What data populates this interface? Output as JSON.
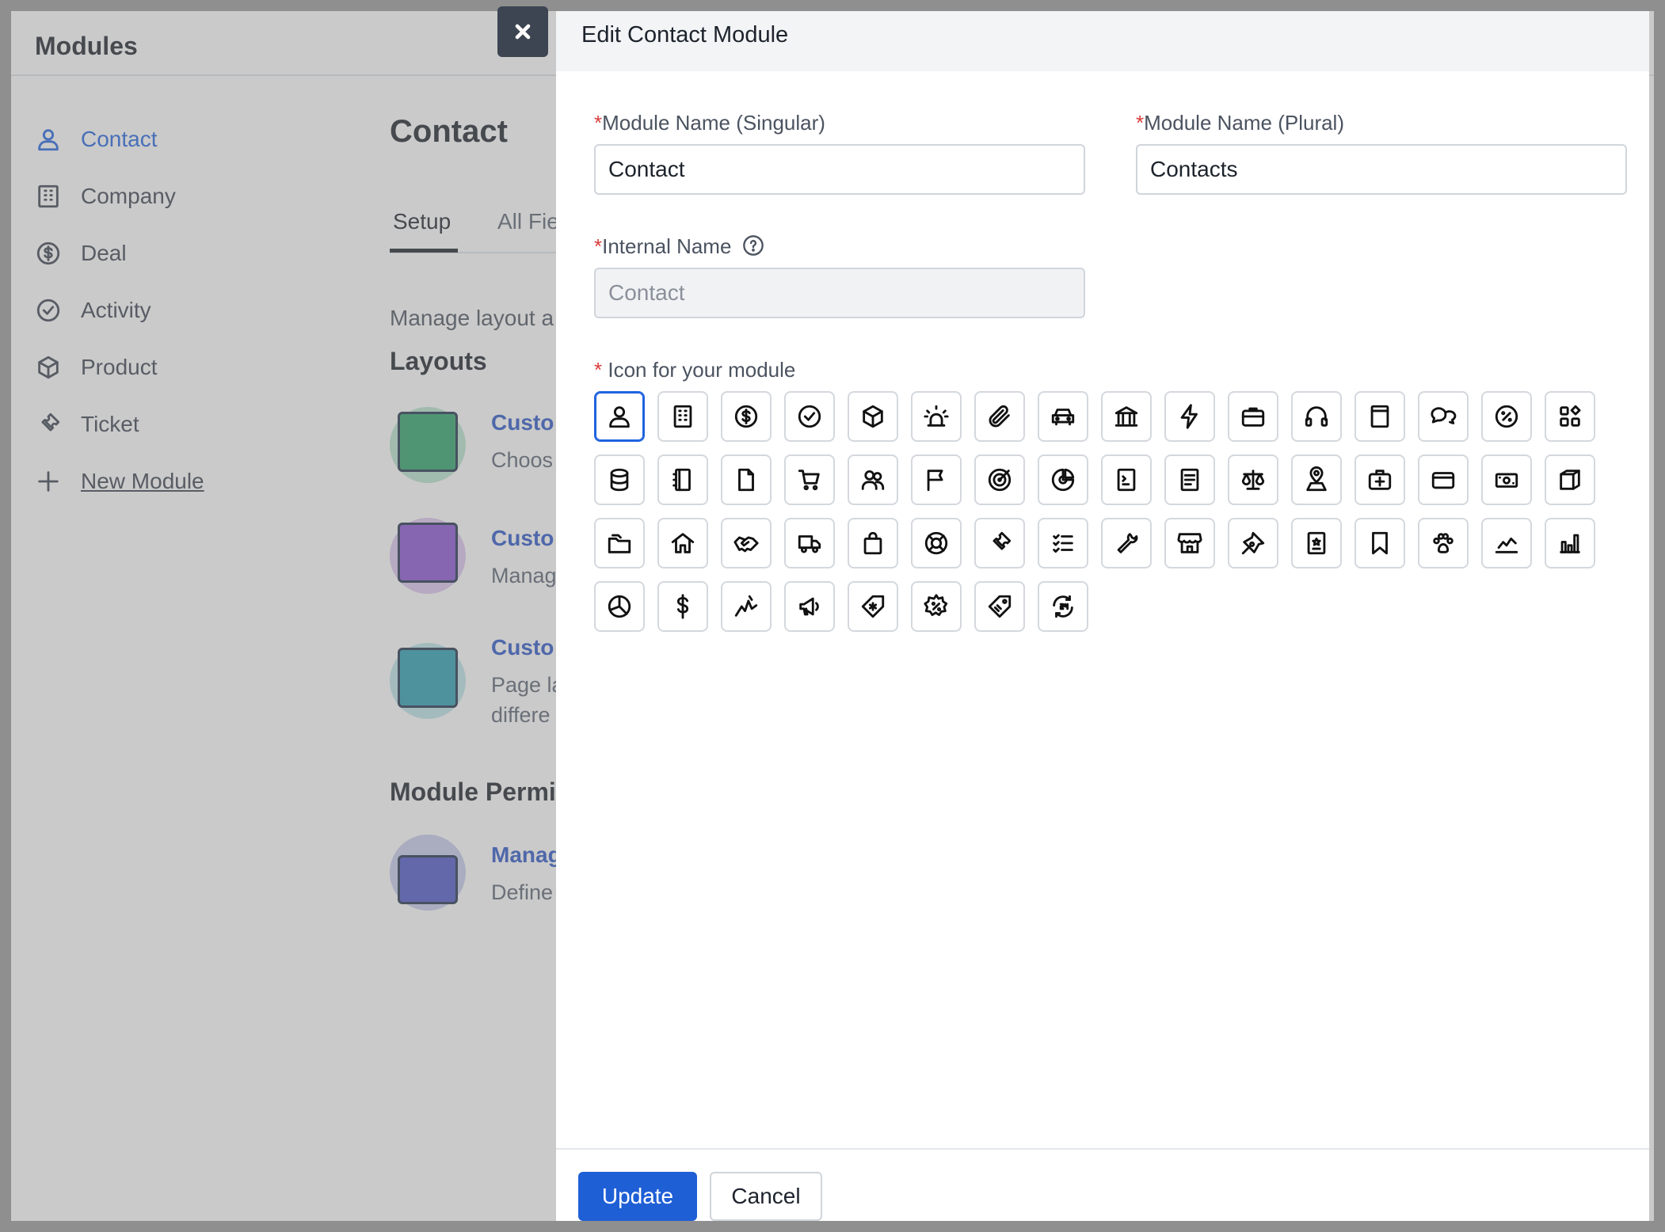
{
  "app": {
    "title": "Modules",
    "sidebar": [
      {
        "label": "Contact",
        "icon": "user-icon",
        "active": true
      },
      {
        "label": "Company",
        "icon": "building-icon"
      },
      {
        "label": "Deal",
        "icon": "dollar-circle-icon"
      },
      {
        "label": "Activity",
        "icon": "check-circle-icon"
      },
      {
        "label": "Product",
        "icon": "box-icon"
      },
      {
        "label": "Ticket",
        "icon": "ticket-icon"
      },
      {
        "label": "New Module",
        "icon": "plus-icon"
      }
    ],
    "main": {
      "title": "Contact",
      "tabs": [
        "Setup",
        "All Fie"
      ],
      "description": "Manage layout a",
      "layouts_heading": "Layouts",
      "cards": [
        {
          "title": "Custo",
          "sub1": "Choos",
          "sub2": ""
        },
        {
          "title": "Custo",
          "sub1": "Manag",
          "sub2": ""
        },
        {
          "title": "Custo",
          "sub1": "Page la",
          "sub2": "differe"
        }
      ],
      "permissions_heading": "Module Permi",
      "perm_card": {
        "title": "Manag",
        "sub1": "Define"
      }
    }
  },
  "drawer": {
    "title": "Edit Contact Module",
    "singular": {
      "label": "Module Name (Singular)",
      "value": "Contact"
    },
    "plural": {
      "label": "Module Name (Plural)",
      "value": "Contacts"
    },
    "internal": {
      "label": "Internal Name",
      "value": "Contact"
    },
    "icon_label": "Icon for your module",
    "required_mark": "*",
    "icons": [
      "user",
      "building",
      "dollar-circle",
      "check-circle",
      "box",
      "siren",
      "paperclip",
      "car",
      "bank",
      "lightning",
      "briefcase",
      "headset",
      "window",
      "chat-bubbles",
      "percent-circle",
      "apps-grid",
      "database",
      "notebook",
      "file",
      "shopping-cart",
      "users",
      "flag",
      "target",
      "chart-donut",
      "terminal",
      "document-list",
      "scale",
      "map-pin",
      "first-aid-kit",
      "credit-card",
      "money",
      "package",
      "folders",
      "home",
      "handshake",
      "truck",
      "shopping-bag",
      "lifebuoy",
      "ticket",
      "checklist",
      "wrench",
      "store",
      "pen-nib",
      "badge-id",
      "bookmark",
      "paw",
      "line-chart",
      "bar-chart",
      "pie-chart",
      "dollar",
      "activity-line",
      "megaphone",
      "tag-asterisk",
      "gear-percent",
      "tag",
      "phone-24"
    ],
    "selected_icon": "user",
    "update_label": "Update",
    "cancel_label": "Cancel",
    "colors": {
      "accent": "#1f5fd6",
      "required": "#d93c3c"
    }
  }
}
